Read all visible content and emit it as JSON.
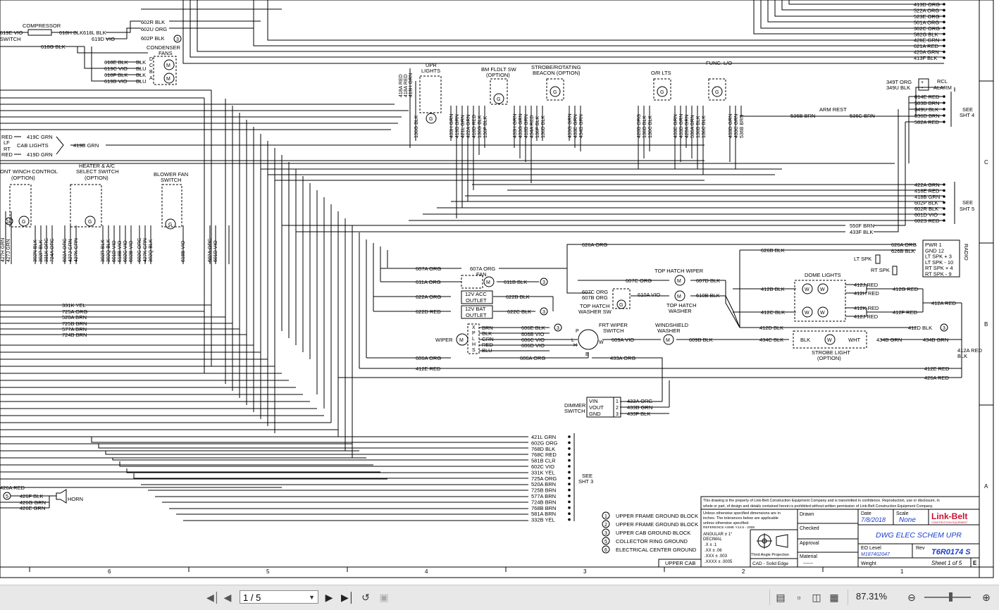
{
  "diagram": {
    "zone_numbers": [
      "6",
      "5",
      "4",
      "3",
      "2",
      "1"
    ],
    "zone_letters": [
      "C",
      "B",
      "A"
    ],
    "top_right_wires": [
      "413D ORG",
      "522A ORG",
      "523E ORG",
      "501A ORG",
      "302C ORG",
      "582G BLK",
      "426E GRN",
      "621A RED",
      "420A GRN",
      "413F BLK"
    ],
    "compressor": {
      "label": "COMPRESSOR",
      "switch": "SWITCH",
      "wires": [
        "619E VIO",
        "618H BLK",
        "618L BLK",
        "619D VIO",
        "618G BLK",
        "602P BLK",
        "602R BLK",
        "602U ORG"
      ]
    },
    "condenser": {
      "label": [
        "CONDENSER",
        "FANS"
      ],
      "wires": [
        "618E BLK",
        "619C VIO",
        "618F BLK",
        "619B VIO"
      ],
      "right": [
        "BLK",
        "BLU",
        "BLK",
        "BLU"
      ],
      "pins": [
        "D",
        "C",
        "B",
        "A"
      ]
    },
    "cab_lights": {
      "label": "CAB LIGHTS",
      "lf": "LF",
      "rt": "RT",
      "wires": [
        "419C GRN",
        "419D GRN",
        "419B GRN"
      ],
      "red": "RED"
    },
    "front_winch": {
      "label": [
        "ONT WINCH CONTROL",
        "(OPTION)"
      ]
    },
    "heater": {
      "label": [
        "HEATER & A/C",
        "SELECT SWITCH",
        "(OPTION)"
      ]
    },
    "blower": {
      "label": [
        "BLOWER FAN",
        "SWITCH"
      ]
    },
    "bottom_left_vert": [
      "427H GRN",
      "427J GRN",
      "302N BLK",
      "302P BLK",
      "331K ORG",
      "724A ORG",
      "602A ORG",
      "427J GRN",
      "427K GRN",
      "302R BLK",
      "302Q BLK",
      "601D VIO",
      "618B VIO",
      "602C VIO",
      "602B VIO",
      "602C ORG",
      "427K GRN",
      "302Q BLK",
      "618B VIO",
      "602A ORG",
      "601D VIO"
    ],
    "mid_left_wires": [
      "331K YEL",
      "725A ORG",
      "520A BRN",
      "725B BRN",
      "577A BRN",
      "724B BRN"
    ],
    "upr_lights": {
      "label": [
        "UPR",
        "LIGHTS"
      ]
    },
    "bm_fldlt": {
      "label": [
        "BM FLDLT SW",
        "(OPTION)"
      ]
    },
    "strobe": {
      "label": [
        "STROBE/ROTATING",
        "BEACON (OPTION)"
      ]
    },
    "or_lts": {
      "label": "O/R LTS"
    },
    "func_lo": {
      "label": "FUNC. L/O"
    },
    "top_vert": [
      "418A RED",
      "418A RED",
      "419H GRN",
      "136G BLK",
      "433H GRN",
      "419B GRN",
      "421L GRN",
      "422A GRN",
      "418D RED",
      "136G BLK",
      "136F BLK",
      "433H GRN",
      "433G GRN",
      "418B GRN",
      "434A RED",
      "136F BLK",
      "136D BLK",
      "433G GRN",
      "433E GRN",
      "434B GRN",
      "420B ORG",
      "136D BLK",
      "136C BLK",
      "433E GRN",
      "433D GRN",
      "420A GRN",
      "536A BRN",
      "136B BLK",
      "136C BLK",
      "433D GRN",
      "433C GRN",
      "536B BRN"
    ],
    "rcl": {
      "label": [
        "RCL",
        "ALARM"
      ],
      "wires": [
        "349T ORG",
        "349U BLK"
      ]
    },
    "see_sht4": {
      "label": [
        "SEE",
        "SHT 4"
      ],
      "wires": [
        "814E RED",
        "583B BRN",
        "349U BLK",
        "536D BRN",
        "582A RED"
      ]
    },
    "arm_rest": {
      "label": "ARM REST",
      "wires": [
        "536B BRN",
        "536C BRN"
      ]
    },
    "see_sht5": {
      "label": [
        "SEE",
        "SHT 5"
      ],
      "wires": [
        "422A GRN",
        "418E RED",
        "418B GRN",
        "602P BLK",
        "602R BLK",
        "601D VIO",
        "602S RED"
      ],
      "extra": [
        "550F BRN",
        "433F BLK"
      ]
    },
    "radio": {
      "label": "RADIO",
      "pins": [
        "PWR 1",
        "GND 12",
        "LT SPK + 3",
        "LT SPK - 10",
        "RT SPK + 4",
        "RT SPK - 9"
      ],
      "wires": [
        "626A ORG",
        "626B BLK"
      ],
      "lt": "LT SPK",
      "rt": "RT SPK"
    },
    "fan": {
      "label": "FAN",
      "wires": [
        "607A ORG",
        "607A ORG",
        "611A ORG",
        "611B BLK",
        "626A ORG",
        "626B BLK"
      ]
    },
    "outlets": {
      "acc": [
        "12V ACC",
        "OUTLET"
      ],
      "bat": [
        "12V BAT",
        "OUTLET"
      ],
      "wires": [
        "622A ORG",
        "622B BLK",
        "622D RED",
        "622C BLK"
      ]
    },
    "top_hatch": {
      "wiper": "TOP HATCH  WIPER",
      "washer_sw": [
        "TOP HATCH",
        "WASHER SW"
      ],
      "washer": [
        "TOP HATCH",
        "WASHER"
      ],
      "wires": [
        "607C ORG",
        "607D BLK",
        "607C ORG",
        "607B ORG",
        "610A VIO",
        "610B BLK"
      ]
    },
    "dome": {
      "label": "DOME LIGHTS",
      "wires": [
        "412B BLK",
        "412J RED",
        "412H RED",
        "412G RED",
        "412C BLK",
        "412K RED",
        "412J RED",
        "412F RED",
        "412A RED",
        "412D BLK",
        "412D BLK"
      ]
    },
    "wiper": {
      "label": "WIPER",
      "pins": [
        "X",
        "P",
        "L",
        "H",
        "S"
      ],
      "colors": [
        "BRN",
        "BLK",
        "GRN",
        "RED",
        "BLU"
      ],
      "wires": [
        "606E BLK",
        "606B VIO",
        "606C VIO",
        "606D VIO",
        "606A ORG",
        "606A ORG"
      ]
    },
    "frt_wiper": {
      "label": [
        "FRT WIPER",
        "SWITCH"
      ],
      "pins": [
        "P",
        "L",
        "H",
        "W",
        "B"
      ],
      "wires": [
        "609A VIO",
        "609B BLK",
        "433A ORG"
      ]
    },
    "windshield": {
      "label": [
        "WINDSHIELD",
        "WASHER"
      ]
    },
    "strobe_light": {
      "label": [
        "STROBE LIGHT",
        "(OPTION)"
      ],
      "wires": [
        "434C BLK",
        "BLK",
        "WHT",
        "434B GRN",
        "434B GRN"
      ]
    },
    "right_mid": [
      "412A RED",
      "412E RED",
      "426A RED"
    ],
    "left_mid": [
      "412E RED",
      "606A ORG"
    ],
    "dimmer": {
      "label": [
        "DIMMER",
        "SWITCH"
      ],
      "pins": [
        "VIN",
        "VOUT",
        "GND"
      ],
      "nums": [
        "1",
        "2",
        "3"
      ],
      "wires": [
        "433A ORG",
        "433B GRN",
        "433F BLK"
      ]
    },
    "see_sht3": {
      "label": [
        "SEE",
        "SHT 3"
      ],
      "wires": [
        "421L GRN",
        "602G ORG",
        "768D BLK",
        "768C RED",
        "581B CLR",
        "602C VIO",
        "331K YEL",
        "725A ORG",
        "520A BRN",
        "725B BRN",
        "577A BRN",
        "724B BRN",
        "768B BRN",
        "581A BRN",
        "332B YEL"
      ]
    },
    "horn": {
      "label": "HORN",
      "wires": [
        "426A RED",
        "426F BLK",
        "426G GRN",
        "426E GRN"
      ],
      "ground": "5"
    },
    "legend": [
      {
        "n": "1",
        "t": "UPPER FRAME GROUND BLOCK"
      },
      {
        "n": "2",
        "t": "UPPER FRAME GROUND BLOCK"
      },
      {
        "n": "3",
        "t": "UPPER CAB GROUND BLOCK"
      },
      {
        "n": "5",
        "t": "COLLECTOR RING GROUND"
      },
      {
        "n": "6",
        "t": "ELECTRICAL CENTER GROUND"
      }
    ],
    "upper_cab": "UPPER CAB",
    "title_block": {
      "notice": [
        "This drawing is the property of Link-Belt Construction Equipment Company and is transmitted in confidence. Reproduction, use or disclosure, in",
        "whole or part, of design and details contained herein is prohibited without written permission of Link-Belt Construction Equipment Company."
      ],
      "unless": [
        "Unless otherwise specified dimensions are in",
        "inches.  The tolerances below are applicable",
        "unless otherwise specified.",
        "REFERENCE ASME Y14.5 - 2009"
      ],
      "angular": "ANGULAR    ± 1°",
      "decimal": "DECIMAL",
      "tol": [
        ".X         ± .1",
        ".XX        ± .06",
        ".XXX     ± .003",
        ".XXXX   ± .0005"
      ],
      "projection": "Third Angle Projection",
      "cad": "CAD - Solid Edge",
      "drawn": "Drawn",
      "checked": "Checked",
      "approval": "Approval",
      "material": "Material",
      "material_val": "------",
      "weight": "Weight",
      "date_lbl": "Date",
      "date": "7/8/2018",
      "scale_lbl": "Scale",
      "scale": "None",
      "brand": "Link-Belt",
      "brand_sub": "CONSTRUCTION EQUIPMENT",
      "title": "DWG ELEC SCHEM UPR",
      "eo_lbl": "EO Level",
      "eo": "M187402047",
      "rev_lbl": "Rev",
      "dwg": "T6R0174 S",
      "sheet": "Sheet 1 of 5",
      "rev": "E"
    }
  },
  "viewer": {
    "page_value": "1 / 5",
    "zoom": "87.31%",
    "buttons": [
      "first-page",
      "prev-page",
      "next-page",
      "last-page",
      "rotate",
      "fit"
    ]
  }
}
